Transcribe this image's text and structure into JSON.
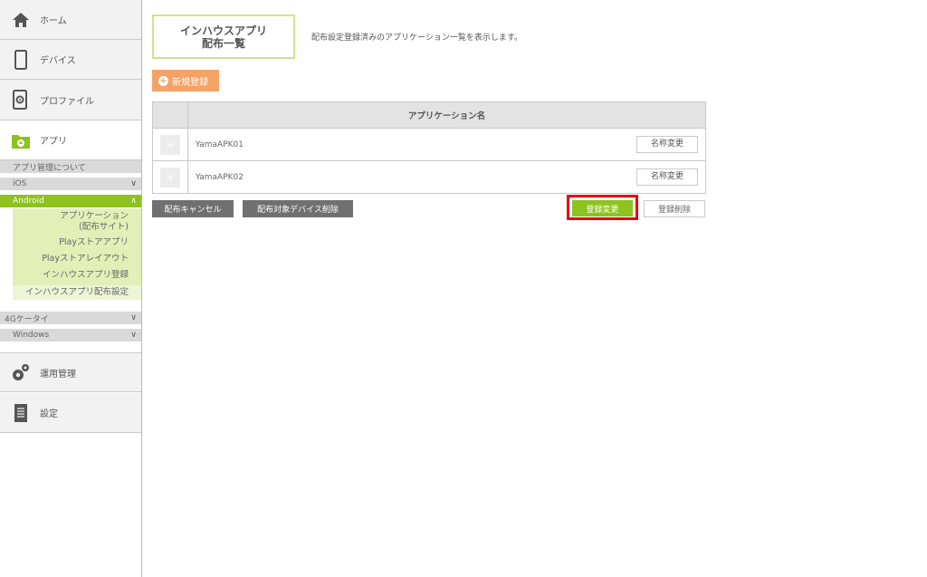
{
  "sidebar": {
    "home": "ホーム",
    "device": "デバイス",
    "profile": "プロファイル",
    "app": "アプリ",
    "app_manage_about": "アプリ管理について",
    "ios": "iOS",
    "android": "Android",
    "android_items": [
      "アプリケーション",
      "(配布サイト)",
      "Playストアアプリ",
      "Playストアレイアウト",
      "インハウスアプリ登録",
      "インハウスアプリ配布設定"
    ],
    "keitai": "4Gケータイ",
    "windows": "Windows",
    "operation": "運用管理",
    "settings": "設定"
  },
  "main": {
    "title_line1": "インハウスアプリ",
    "title_line2": "配布一覧",
    "description": "配布設定登録済みのアプリケーション一覧を表示します。",
    "new_button": "新規登録",
    "table_header": "アプリケーション名",
    "rows": [
      {
        "name": "YamaAPK01",
        "action": "名称変更"
      },
      {
        "name": "YamaAPK02",
        "action": "名称変更"
      }
    ],
    "cancel_button": "配布キャンセル",
    "remove_devices_button": "配布対象デバイス削除",
    "update_button": "登録変更",
    "delete_button": "登録削除"
  },
  "colors": {
    "accent_green": "#8dc21f",
    "new_orange": "#f5a266",
    "highlight_red": "#e60012"
  }
}
